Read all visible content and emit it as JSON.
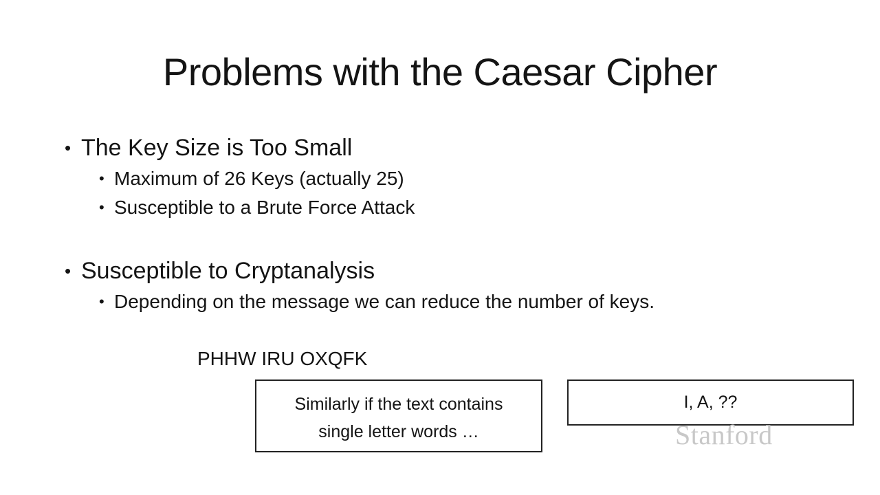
{
  "slide": {
    "title": "Problems with the Caesar Cipher",
    "bullets": [
      {
        "text": "The Key Size is Too Small",
        "sub": [
          "Maximum of 26 Keys (actually 25)",
          "Susceptible to a Brute Force Attack"
        ]
      },
      {
        "text": "Susceptible to Cryptanalysis",
        "sub": [
          "Depending on the message we can reduce the number of keys."
        ]
      }
    ],
    "bullet_glyph": "•",
    "cipher_text": "PHHW IRU OXQFK",
    "box_left": {
      "line1": "Similarly if the text contains",
      "line2": "single letter words …"
    },
    "box_right": {
      "text": "I, A, ??"
    },
    "watermark": "Stanford"
  }
}
